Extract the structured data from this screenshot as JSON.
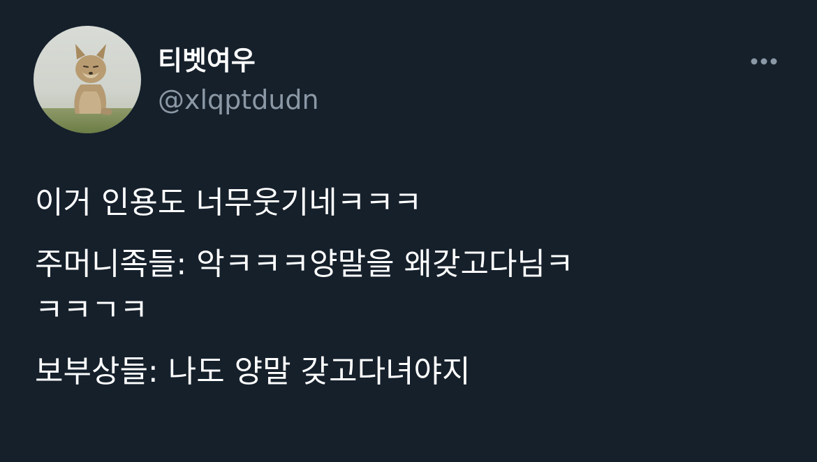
{
  "author": {
    "display_name": "티벳여우",
    "handle": "@xlqptdudn",
    "avatar_icon": "tibetan-fox-avatar-icon"
  },
  "menu": {
    "icon": "more-horizontal-icon"
  },
  "tweet": {
    "lines": [
      "이거 인용도 너무웃기네ㅋㅋㅋ",
      "주머니족들: 악ㅋㅋㅋ양말을 왜갖고다님ㅋ",
      "ㅋㅋㄱㅋ",
      "보부상들: 나도 양말 갖고다녀야지"
    ]
  },
  "colors": {
    "background": "#15202b",
    "text_primary": "#ffffff",
    "text_secondary": "#8b98a5"
  }
}
